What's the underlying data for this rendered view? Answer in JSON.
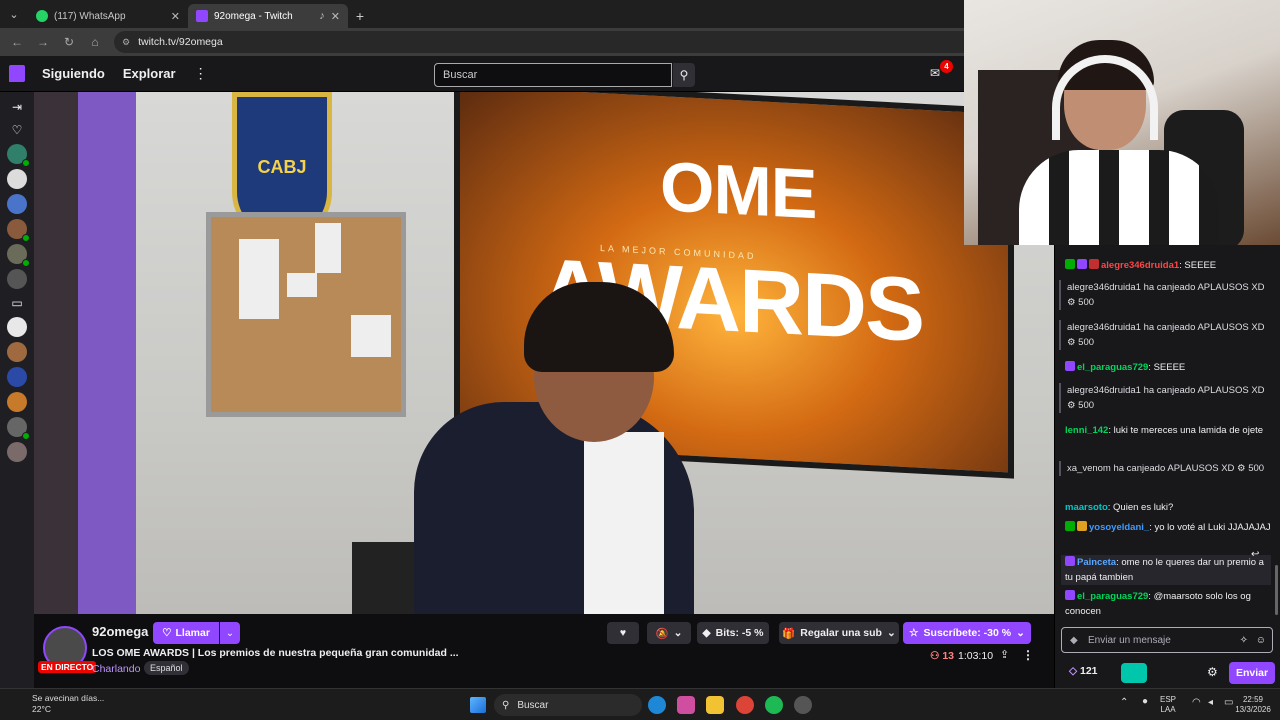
{
  "browser": {
    "tabs": [
      {
        "title": "(117) WhatsApp",
        "close": "✕"
      },
      {
        "title": "92omega - Twitch",
        "close": "✕"
      }
    ],
    "url": "twitch.tv/92omega"
  },
  "twitch_nav": {
    "following": "Siguiendo",
    "browse": "Explorar",
    "search_placeholder": "Buscar",
    "notification_count": "4"
  },
  "stream_video": {
    "tv_line1": "OME",
    "tv_line2": "AWARDS",
    "tv_subtitle": "LA MEJOR COMUNIDAD",
    "shield_text": "CABJ"
  },
  "stream_info": {
    "channel": "92omega",
    "live_label": "EN DIRECTO",
    "follow_label": "Llamar",
    "title": "LOS OME AWARDS | Los premios de nuestra pequeña gran comunidad ...",
    "category": "Charlando",
    "tag": "Español",
    "bits_label": "Bits: -5 %",
    "gift_label": "Regalar una sub",
    "subscribe_label": "Suscríbete: -30 %",
    "viewers": "13",
    "uptime": "1:03:10"
  },
  "chat": {
    "messages": [
      {
        "type": "msg",
        "user": "alegre346druida1",
        "text": ": SEEEE",
        "color": "#ff4545"
      },
      {
        "type": "sys",
        "text": "alegre346druida1 ha canjeado APLAUSOS XD",
        "cost": "500"
      },
      {
        "type": "sys",
        "text": "alegre346druida1 ha canjeado APLAUSOS XD",
        "cost": "500"
      },
      {
        "type": "msg",
        "user": "el_paraguas729",
        "text": ": SEEEE",
        "color": "#00d65b"
      },
      {
        "type": "sys",
        "text": "alegre346druida1 ha canjeado APLAUSOS XD",
        "cost": "500"
      },
      {
        "type": "msg",
        "user": "lenni_142",
        "text": ": luki te mereces una lamida de ojete",
        "color": "#00d65b"
      },
      {
        "type": "sys",
        "text": "xa_venom ha canjeado APLAUSOS XD",
        "cost": "500"
      },
      {
        "type": "msg",
        "user": "maarsoto",
        "text": ": Quien es luki?",
        "color": "#00c7c7"
      },
      {
        "type": "msg",
        "user": "yosoyeldani_",
        "text": ": yo lo voté al Luki JJAJAJAJ",
        "color": "#3d9bff"
      },
      {
        "type": "msg",
        "user": "Painceta",
        "text": ": ome no le queres dar un premio a tu papá tambien",
        "color": "#5aa7ff"
      },
      {
        "type": "msg",
        "user": "el_paraguas729",
        "text": ": @maarsoto solo los og conocen",
        "color": "#00d65b"
      }
    ],
    "input_placeholder": "Enviar un mensaje",
    "points": "121",
    "send_label": "Enviar"
  },
  "taskbar": {
    "weather_text": "Se avecinan días...",
    "temperature": "22°C",
    "search_label": "Buscar",
    "lang": "ESP",
    "lang2": "LAA",
    "time": "22:59",
    "date": "13/3/2026"
  },
  "colors": {
    "twitch_purple": "#9146ff",
    "live_red": "#eb0400",
    "bg": "#0e0e10"
  }
}
